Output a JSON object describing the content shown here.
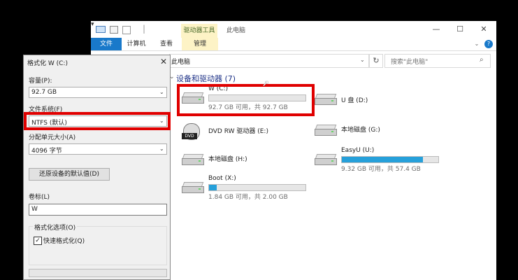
{
  "explorer": {
    "title_context_tab": "驱动器工具",
    "title": "此电脑",
    "window_controls": {
      "min": "—",
      "max": "☐",
      "close": "✕"
    },
    "ribbon_tabs": {
      "file": "文件",
      "computer": "计算机",
      "view": "查看",
      "manage": "管理"
    },
    "ribbon_collapse": "⌄",
    "ribbon_help": "?",
    "address": {
      "text": "此电脑",
      "dropdown": "⌄",
      "refresh": "↻"
    },
    "search": {
      "placeholder": "搜索\"此电脑\"",
      "icon": "⌕"
    },
    "group_header": "设备和驱动器 (7)",
    "group_chevron": "⌄",
    "drives": [
      {
        "name": "W (C:)",
        "info": "92.7 GB 可用，共 92.7 GB",
        "used_fraction": 0.0
      },
      {
        "name": "U 盘 (D:)",
        "info": "",
        "used_fraction": null
      },
      {
        "name": "DVD RW 驱动器 (E:)",
        "info": "",
        "used_fraction": null,
        "icon_label": "DVD"
      },
      {
        "name": "本地磁盘 (G:)",
        "info": "",
        "used_fraction": null
      },
      {
        "name": "本地磁盘 (H:)",
        "info": "",
        "used_fraction": null
      },
      {
        "name": "EasyU (U:)",
        "info": "9.32 GB 可用，共 57.4 GB",
        "used_fraction": 0.84
      },
      {
        "name": "Boot (X:)",
        "info": "1.84 GB 可用，共 2.00 GB",
        "used_fraction": 0.08
      }
    ],
    "colors": {
      "accent": "#1979ca",
      "bar_fill": "#26a0da",
      "highlight": "#e00000"
    }
  },
  "dialog": {
    "title": "格式化 W (C:)",
    "close": "✕",
    "capacity_label": "容量(P):",
    "capacity_value": "92.7 GB",
    "fs_label": "文件系统(F)",
    "fs_value": "NTFS (默认)",
    "alloc_label": "分配单元大小(A)",
    "alloc_value": "4096 字节",
    "restore_button": "还原设备的默认值(D)",
    "volume_label": "卷标(L)",
    "volume_value": "W",
    "options_title": "格式化选项(O)",
    "quick_format_label": "快速格式化(Q)",
    "quick_format_checked": "✓",
    "select_arrow": "⌄"
  }
}
